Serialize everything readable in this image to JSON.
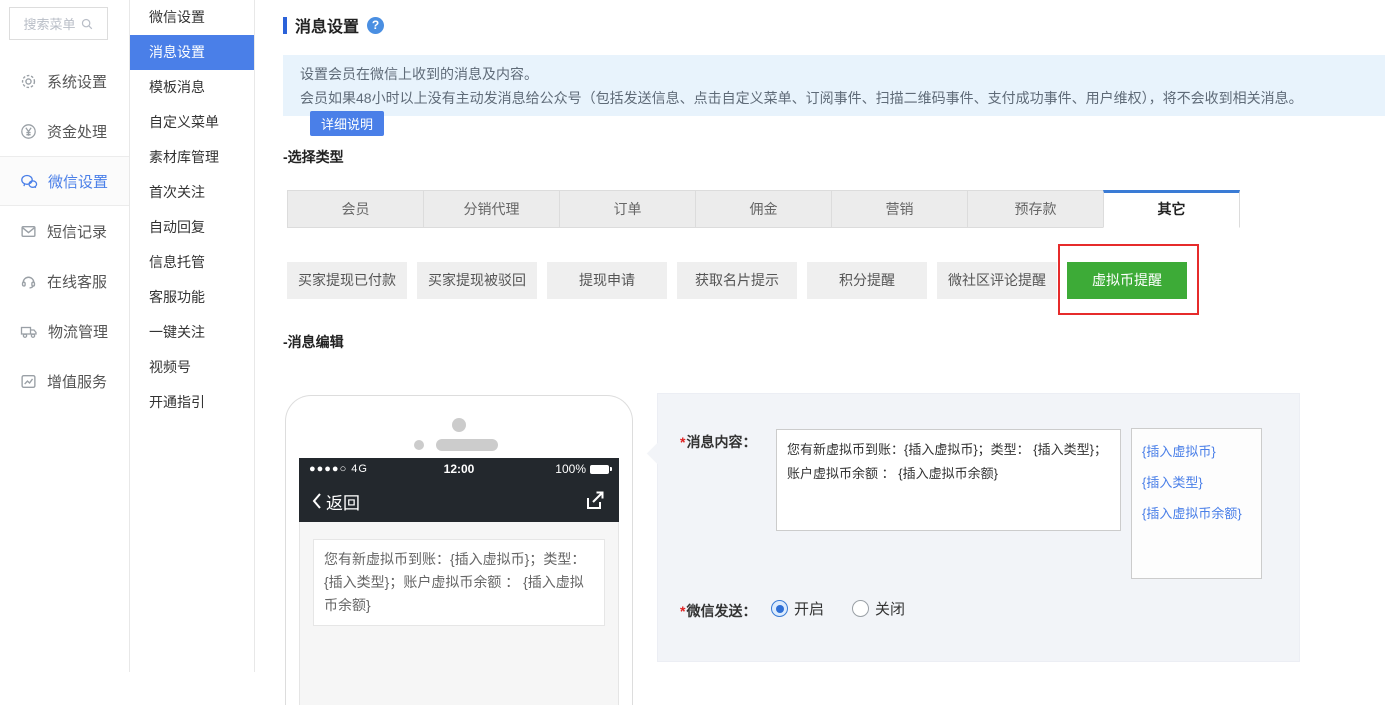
{
  "sidebar": {
    "search_placeholder": "搜索菜单",
    "items": [
      {
        "label": "系统设置",
        "icon": "gear-icon"
      },
      {
        "label": "资金处理",
        "icon": "yen-icon"
      },
      {
        "label": "微信设置",
        "icon": "wechat-icon",
        "active": true
      },
      {
        "label": "短信记录",
        "icon": "envelope-icon"
      },
      {
        "label": "在线客服",
        "icon": "headset-icon"
      },
      {
        "label": "物流管理",
        "icon": "truck-icon"
      },
      {
        "label": "增值服务",
        "icon": "chart-icon"
      }
    ]
  },
  "submenu": {
    "active": "消息设置",
    "items": [
      "微信设置",
      "消息设置",
      "模板消息",
      "自定义菜单",
      "素材库管理",
      "首次关注",
      "自动回复",
      "信息托管",
      "客服功能",
      "一键关注",
      "视频号",
      "开通指引"
    ]
  },
  "main": {
    "title": "消息设置",
    "notice": {
      "line1": "设置会员在微信上收到的消息及内容。",
      "line2": "会员如果48小时以上没有主动发消息给公众号（包括发送信息、点击自定义菜单、订阅事件、扫描二维码事件、支付成功事件、用户维权），将不会收到相关消息。",
      "button": "详细说明"
    },
    "select_type_label": "-选择类型",
    "tabs": [
      "会员",
      "分销代理",
      "订单",
      "佣金",
      "营销",
      "预存款",
      "其它"
    ],
    "active_tab": "其它",
    "type_buttons": [
      "买家提现已付款",
      "买家提现被驳回",
      "提现申请",
      "获取名片提示",
      "积分提醒",
      "微社区评论提醒",
      "虚拟币提醒"
    ],
    "active_type_button": "虚拟币提醒",
    "message_edit_label": "-消息编辑"
  },
  "phone": {
    "signal": "●●●●○ 4G",
    "time": "12:00",
    "battery": "100%",
    "back_label": "返回",
    "message": "您有新虚拟币到账：{插入虚拟币}；类型：{插入类型}；账户虚拟币余额 ： {插入虚拟币余额}"
  },
  "form": {
    "required_marker": "*",
    "content_label": "消息内容：",
    "content_value": "您有新虚拟币到账：{插入虚拟币}；类型： {插入类型}；账户虚拟币余额 ： {插入虚拟币余额}",
    "insert_links": [
      "{插入虚拟币}",
      "{插入类型}",
      "{插入虚拟币余额}"
    ],
    "send_label": "微信发送：",
    "radio_on": "开启",
    "radio_off": "关闭",
    "send_state": "开启"
  },
  "colors": {
    "accent_blue": "#4a7fe8",
    "tab_active_border": "#3a7bd5",
    "active_green": "#3dab37",
    "annotation_red": "#e62b2b",
    "notice_bg": "#e8f3fc"
  }
}
